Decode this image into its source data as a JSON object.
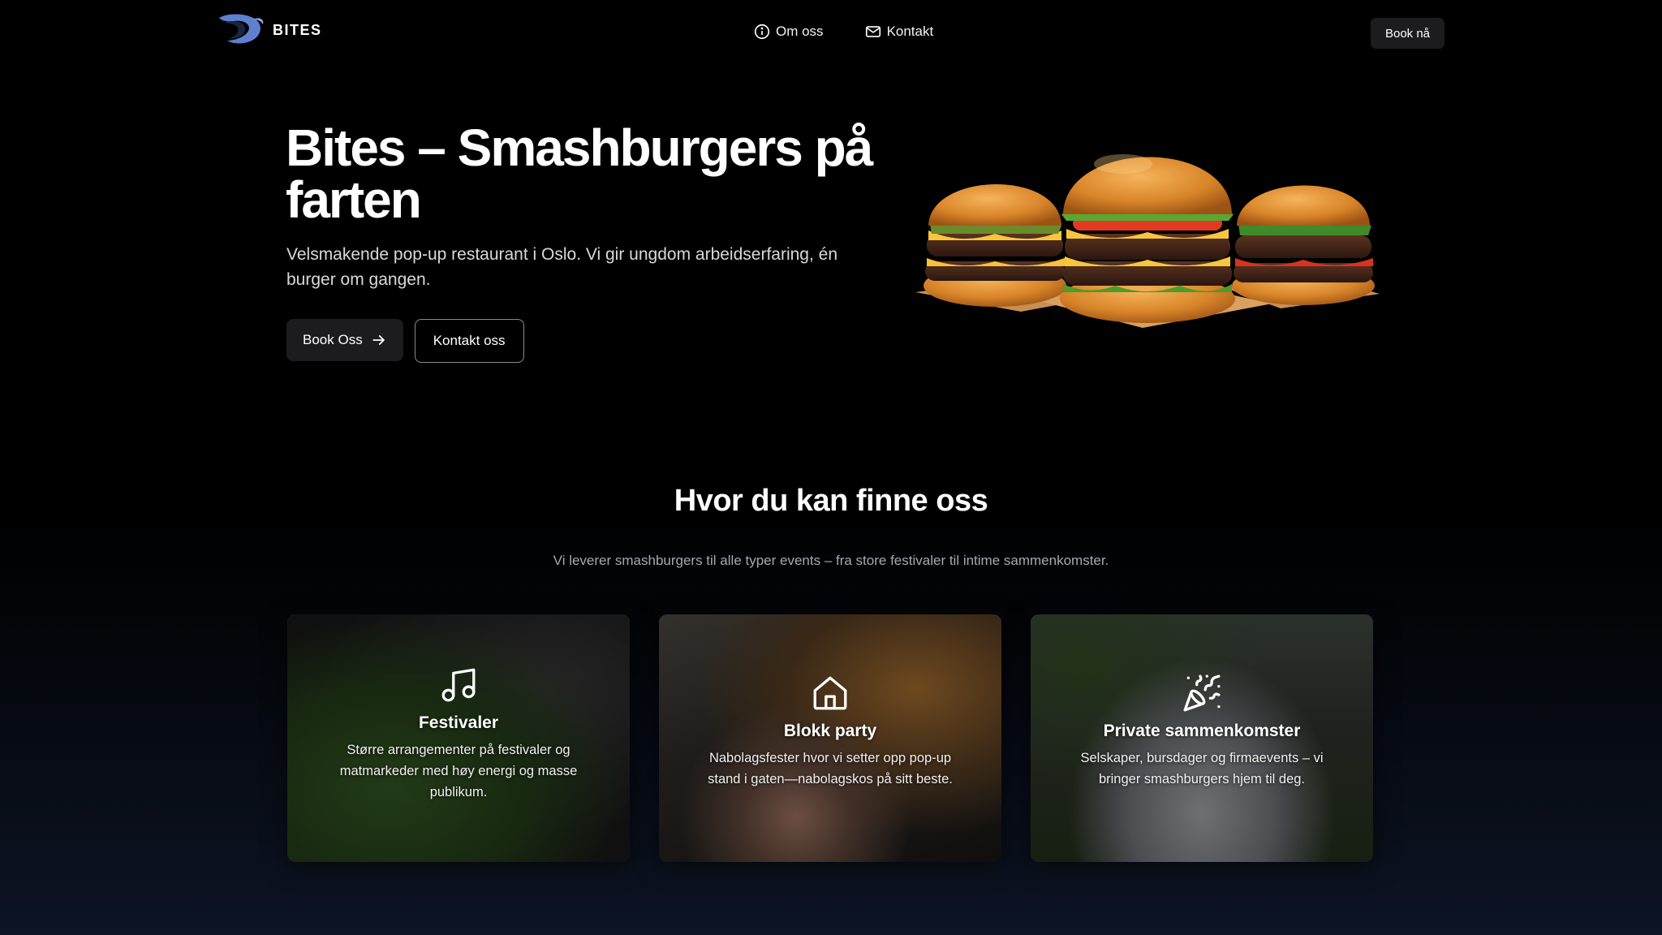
{
  "brand": {
    "name": "BITES",
    "logo_icon": "fish-swoosh-icon",
    "accent": "#5f7fcf"
  },
  "nav": {
    "items": [
      {
        "label": "Om oss",
        "icon": "info-circle-icon"
      },
      {
        "label": "Kontakt",
        "icon": "mail-icon"
      }
    ],
    "cta": "Book nå"
  },
  "hero": {
    "title": "Bites – Smashburgers på farten",
    "subtitle": "Velsmakende pop-up restaurant i Oslo. Vi gir ungdom arbeidserfaring, én burger om gangen.",
    "primary_button": "Book Oss",
    "primary_icon": "arrow-right-icon",
    "secondary_button": "Kontakt oss",
    "image": "three-smashburgers-image"
  },
  "section": {
    "title": "Hvor du kan finne oss",
    "subtitle": "Vi leverer smashburgers til alle typer events – fra store festivaler til intime sammenkomster.",
    "cards": [
      {
        "title": "Festivaler",
        "description": "Større arrangementer på festivaler og matmarkeder med høy energi og masse publikum.",
        "icon": "music-note-icon"
      },
      {
        "title": "Blokk party",
        "description": "Nabolagsfester hvor vi setter opp pop-up stand i gaten—nabolagskos på sitt beste.",
        "icon": "house-icon"
      },
      {
        "title": "Private sammenkomster",
        "description": "Selskaper, bursdager og firmaevents – vi bringer smashburgers hjem til deg.",
        "icon": "party-popper-icon"
      }
    ]
  }
}
